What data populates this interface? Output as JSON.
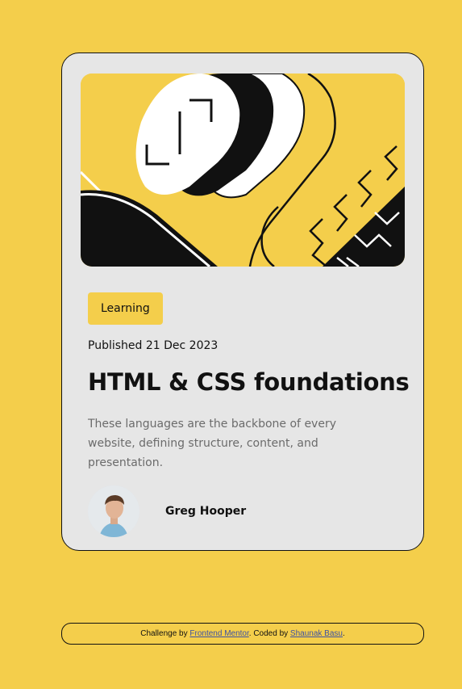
{
  "card": {
    "tag": "Learning",
    "published": "Published 21 Dec 2023",
    "title": "HTML & CSS foundations",
    "description": "These languages are the backbone of every website, defining structure, content, and presentation.",
    "author": {
      "name": "Greg Hooper"
    }
  },
  "footer": {
    "challenge_prefix": "Challenge by ",
    "challenge_link": "Frontend Mentor",
    "coded_prefix": ". Coded by ",
    "coded_link": "Shaunak Basu",
    "suffix": "."
  },
  "colors": {
    "background": "#f4ce4b",
    "card": "#e6e6e6",
    "text": "#111111",
    "muted": "#6b6b6b",
    "link": "#3e52a3"
  },
  "icons": {
    "hero": "abstract-illustration",
    "avatar": "author-photo"
  }
}
